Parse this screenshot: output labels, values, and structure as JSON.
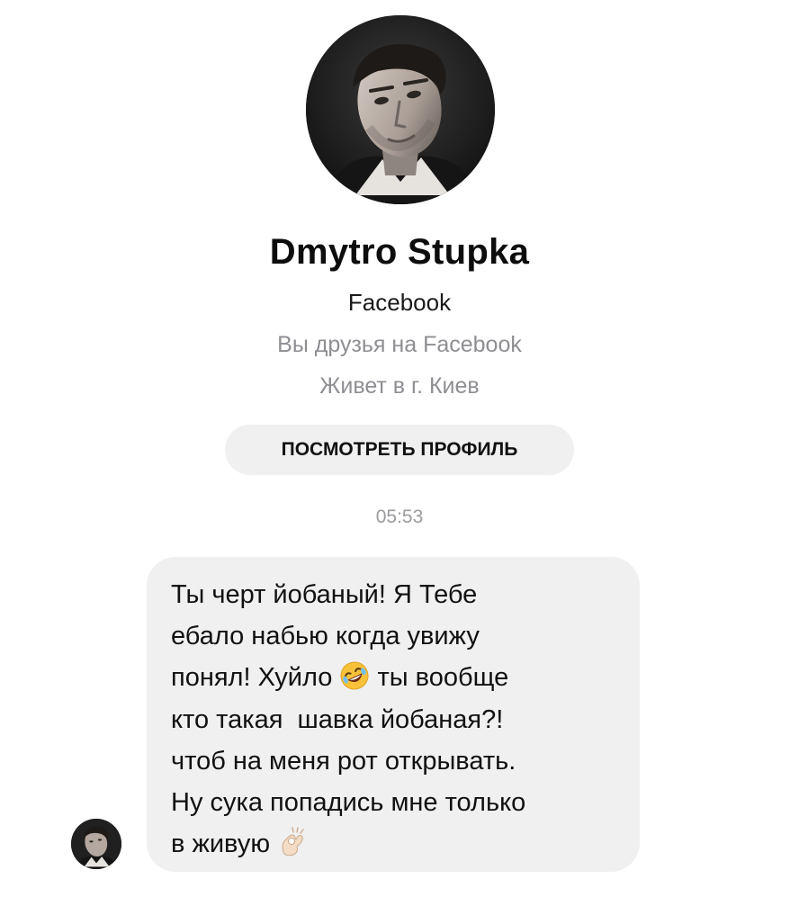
{
  "contact": {
    "name": "Dmytro Stupka",
    "platform": "Facebook",
    "friends_status": "Вы друзья на Facebook",
    "location": "Живет в г. Киев",
    "view_profile_label": "ПОСМОТРЕТЬ ПРОФИЛЬ"
  },
  "conversation": {
    "timestamp": "05:53",
    "message": {
      "lines": [
        {
          "before": "Ты черт йобаный! Я Тебе",
          "after": ""
        },
        {
          "before": "ебало набью когда увижу",
          "after": ""
        },
        {
          "before": "понял! Хуйло ",
          "emoji": "rolling-on-floor-laughing-emoji",
          "after": " ты вообще"
        },
        {
          "before": "кто такая  шавка йобаная?!",
          "after": ""
        },
        {
          "before": "чтоб на меня рот открывать.",
          "after": ""
        },
        {
          "before": "Ну сука попадись мне только",
          "after": ""
        },
        {
          "before": "в живую ",
          "emoji": "ok-hand-emoji",
          "after": ""
        }
      ]
    }
  },
  "colors": {
    "bubble_background": "#f0f0f0",
    "secondary_text": "#8e8e93",
    "primary_text": "#111111"
  }
}
